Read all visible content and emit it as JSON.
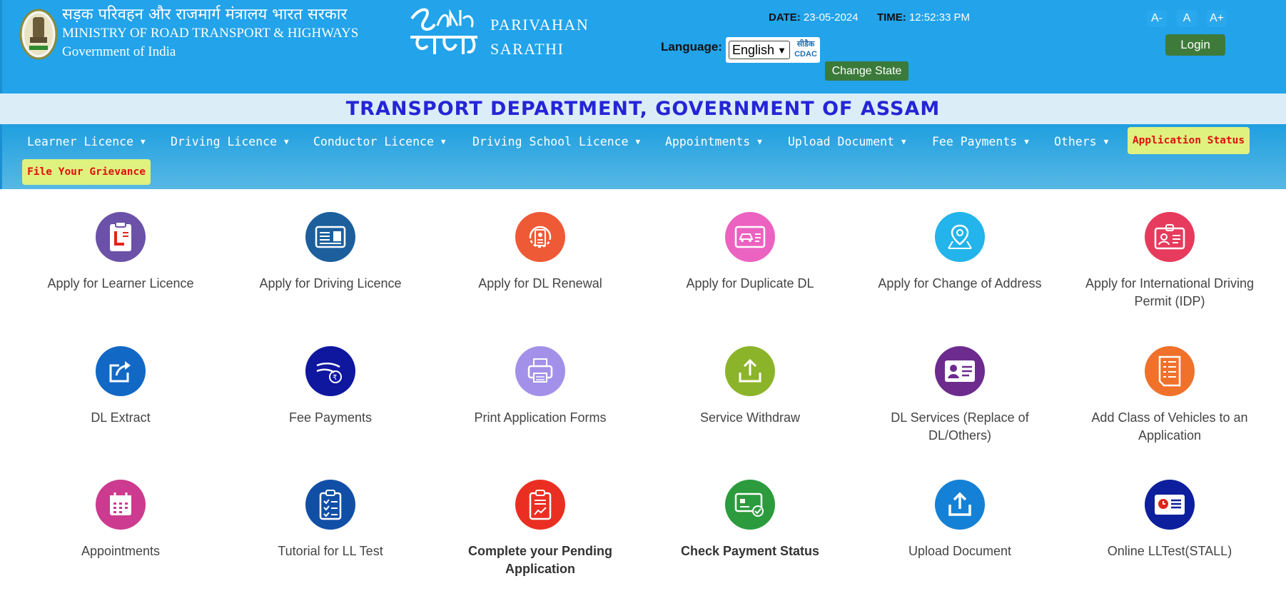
{
  "header": {
    "ministry_hindi": "सड़क परिवहन और राजमार्ग मंत्रालय भारत सरकार",
    "ministry_english": "MINISTRY OF ROAD TRANSPORT & HIGHWAYS",
    "government": "Government of India",
    "brand_line1": "PARIVAHAN",
    "brand_line2": "SARATHI",
    "date_label": "DATE:",
    "date_value": "23-05-2024",
    "time_label": "TIME:",
    "time_value": "12:52:33 PM",
    "language_label": "Language:",
    "language_selected": "English",
    "cdac_top": "सीडैक",
    "cdac_bottom": "CDAC",
    "change_state_label": "Change State",
    "font_decrease": "A-",
    "font_normal": "A",
    "font_increase": "A+",
    "login_label": "Login"
  },
  "department_title": "TRANSPORT DEPARTMENT, GOVERNMENT OF ASSAM",
  "nav": {
    "items": [
      "Learner Licence",
      "Driving Licence",
      "Conductor Licence",
      "Driving School Licence",
      "Appointments",
      "Upload Document",
      "Fee Payments",
      "Others"
    ],
    "application_status": "Application Status",
    "file_grievance": "File Your Grievance"
  },
  "tiles": [
    {
      "label": "Apply for Learner Licence",
      "color": "#6b51a8",
      "icon": "learner-licence-icon"
    },
    {
      "label": "Apply for Driving Licence",
      "color": "#1c5f9c",
      "icon": "driving-licence-icon"
    },
    {
      "label": "Apply for DL Renewal",
      "color": "#ee5a36",
      "icon": "dl-renewal-icon"
    },
    {
      "label": "Apply for Duplicate DL",
      "color": "#ec62c0",
      "icon": "duplicate-dl-icon"
    },
    {
      "label": "Apply for Change of Address",
      "color": "#22b4ea",
      "icon": "map-pin-icon"
    },
    {
      "label": "Apply for International Driving Permit (IDP)",
      "color": "#e63b5d",
      "icon": "idp-card-icon"
    },
    {
      "label": "DL Extract",
      "color": "#1268c5",
      "icon": "share-icon"
    },
    {
      "label": "Fee Payments",
      "color": "#0f179f",
      "icon": "rupee-hand-icon"
    },
    {
      "label": "Print Application Forms",
      "color": "#a391e9",
      "icon": "printer-icon"
    },
    {
      "label": "Service Withdraw",
      "color": "#8cb42a",
      "icon": "upload-tray-icon"
    },
    {
      "label": "DL Services (Replace of DL/Others)",
      "color": "#6d2b8e",
      "icon": "id-card-icon"
    },
    {
      "label": "Add Class of Vehicles to an Application",
      "color": "#f0712a",
      "icon": "document-list-icon"
    },
    {
      "label": "Appointments",
      "color": "#cc3b8f",
      "icon": "calendar-icon"
    },
    {
      "label": "Tutorial for LL Test",
      "color": "#114fa7",
      "icon": "checklist-icon"
    },
    {
      "label": "Complete your Pending Application",
      "color": "#ea2f22",
      "icon": "report-icon"
    },
    {
      "label": "Check Payment Status",
      "color": "#2c9b3d",
      "icon": "payment-card-icon"
    },
    {
      "label": "Upload Document",
      "color": "#1481d6",
      "icon": "upload-box-icon"
    },
    {
      "label": "Online LLTest(STALL)",
      "color": "#0d1f9c",
      "icon": "clock-card-icon"
    }
  ]
}
